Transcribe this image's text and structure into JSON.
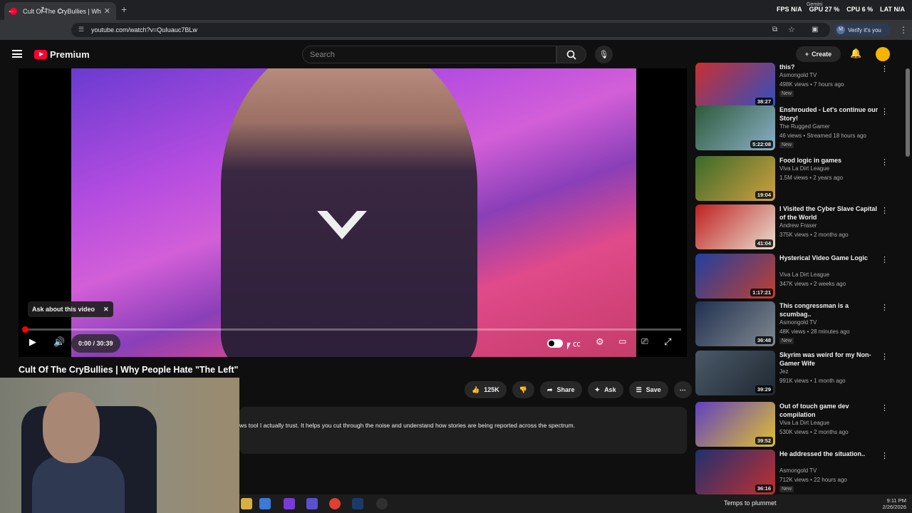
{
  "browser": {
    "tab_title": "Cult Of The CryBullies | Why Pe",
    "url": "youtube.com/watch?v=QuIuauc7BLw",
    "verify_label": "Verify it's you",
    "verify_avatar": "M",
    "perf": {
      "fps_label": "FPS",
      "fps": "N/A",
      "gpu_label": "GPU",
      "gpu": "27 %",
      "cpu_label": "CPU",
      "cpu": "6 %",
      "lat_label": "LAT",
      "lat": "N/A",
      "small_label": "Gemini"
    }
  },
  "yt": {
    "logo": "Premium",
    "search_placeholder": "Search",
    "create_label": "Create"
  },
  "player": {
    "ask_chip": "Ask about this video",
    "time": "0:00 / 30:39"
  },
  "video": {
    "title": "Cult Of The CryBullies | Why People Hate \"The Left\"",
    "likes": "125K",
    "share": "Share",
    "ask": "Ask",
    "save": "Save",
    "desc": "ws tool I actually trust. It helps you cut through the noise and understand how stories are being reported across the spectrum."
  },
  "recs": [
    {
      "title": "this?",
      "channel": "Asmongold TV",
      "meta": "498K views • 7 hours ago",
      "badge": "New",
      "dur": "38:27",
      "c1": "#c83030",
      "c2": "#3050c0"
    },
    {
      "title": "Enshrouded - Let's continue our Story!",
      "channel": "The Rugged Gamer",
      "meta": "46 views • Streamed 18 hours ago",
      "badge": "New",
      "dur": "5:22:08",
      "c1": "#2e5a3a",
      "c2": "#8ab0c8"
    },
    {
      "title": "Food logic in games",
      "channel": "Viva La Dirt League",
      "meta": "1.5M views • 2 years ago",
      "badge": "",
      "dur": "19:04",
      "c1": "#3a6a2a",
      "c2": "#d0a040"
    },
    {
      "title": "I Visited the Cyber Slave Capital of the World",
      "channel": "Andrew Fraser",
      "meta": "375K views • 2 months ago",
      "badge": "",
      "dur": "41:04",
      "c1": "#c02020",
      "c2": "#e8e0d0"
    },
    {
      "title": "Hysterical Video Game Logic",
      "channel": "Viva La Dirt League",
      "meta": "347K views • 2 weeks ago",
      "badge": "",
      "dur": "1:17:21",
      "c1": "#2040a0",
      "c2": "#c04030"
    },
    {
      "title": "This congressman is a scumbag..",
      "channel": "Asmongold TV",
      "meta": "48K views • 28 minutes ago",
      "badge": "New",
      "dur": "36:48",
      "c1": "#203050",
      "c2": "#808890"
    },
    {
      "title": "Skyrim was weird for my Non-Gamer Wife",
      "channel": "Jez",
      "meta": "991K views • 1 month ago",
      "badge": "",
      "dur": "39:29",
      "c1": "#4a5a6a",
      "c2": "#202830"
    },
    {
      "title": "Out of touch game dev compilation",
      "channel": "Viva La Dirt League",
      "meta": "530K views • 2 months ago",
      "badge": "",
      "dur": "39:52",
      "c1": "#6040c0",
      "c2": "#e0c030"
    },
    {
      "title": "He addressed the situation..",
      "channel": "Asmongold TV",
      "meta": "712K views • 22 hours ago",
      "badge": "New",
      "dur": "36:16",
      "c1": "#203070",
      "c2": "#c03030"
    }
  ],
  "taskbar": {
    "temp": "Temps to plummet",
    "time": "9:11 PM",
    "date": "2/26/2026"
  }
}
